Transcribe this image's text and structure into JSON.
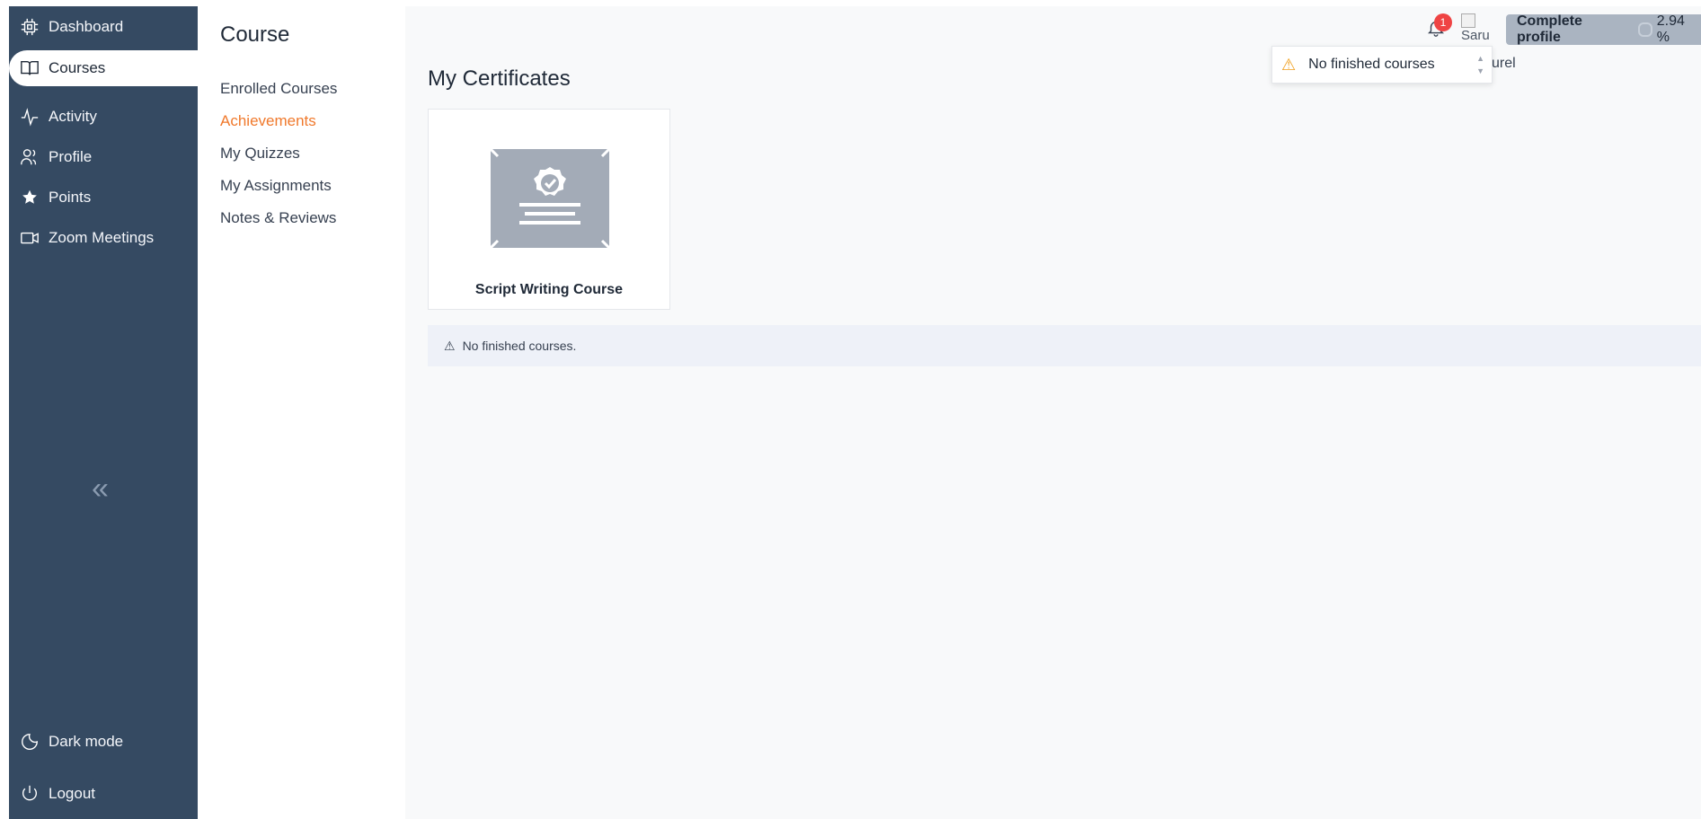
{
  "sidebar": {
    "items": [
      {
        "label": "Dashboard",
        "icon": "dashboard-icon"
      },
      {
        "label": "Courses",
        "icon": "book-icon"
      },
      {
        "label": "Activity",
        "icon": "activity-icon"
      },
      {
        "label": "Profile",
        "icon": "users-icon"
      },
      {
        "label": "Points",
        "icon": "star-icon"
      },
      {
        "label": "Zoom Meetings",
        "icon": "video-icon"
      }
    ],
    "collapse_glyph": "«",
    "bottom": [
      {
        "label": "Dark mode",
        "icon": "moon-icon"
      },
      {
        "label": "Logout",
        "icon": "power-icon"
      }
    ]
  },
  "subnav": {
    "title": "Course",
    "links": [
      "Enrolled Courses",
      "Achievements",
      "My Quizzes",
      "My Assignments",
      "Notes & Reviews"
    ],
    "active": "Achievements"
  },
  "header": {
    "notification_count": "1",
    "avatar_alt": "Saru",
    "username_partial": "urel",
    "complete_profile_label": "Complete profile",
    "complete_profile_percent": "2.94 %"
  },
  "tooltip": {
    "text": "No finished courses"
  },
  "main": {
    "title": "My Certificates",
    "certificates": [
      {
        "title": "Script Writing Course"
      }
    ],
    "alert_text": "No finished courses."
  },
  "colors": {
    "sidebar_bg": "#354a62",
    "accent": "#f0792c",
    "badge": "#ef4444",
    "warning": "#f0a020"
  }
}
